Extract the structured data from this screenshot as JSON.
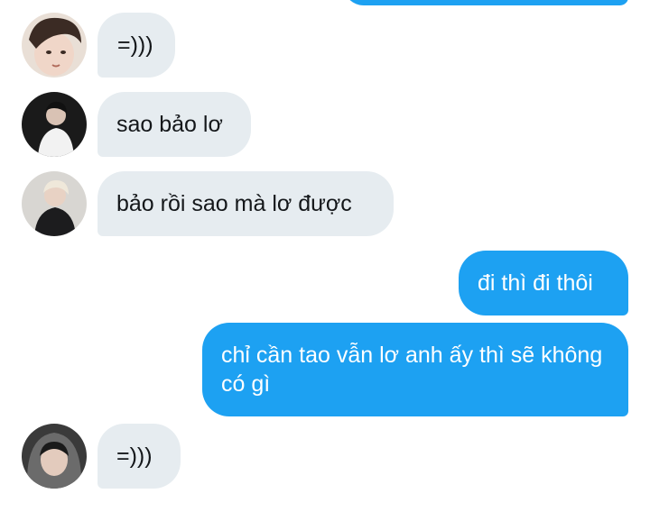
{
  "conversation": {
    "messages": [
      {
        "side": "incoming",
        "avatar": "avatar-1",
        "text": "=)))"
      },
      {
        "side": "incoming",
        "avatar": "avatar-2",
        "text": "sao bảo lơ"
      },
      {
        "side": "incoming",
        "avatar": "avatar-3",
        "text": "bảo rồi sao mà lơ được"
      },
      {
        "side": "outgoing",
        "text": "đi thì đi thôi"
      },
      {
        "side": "outgoing",
        "text": "chỉ cần tao vẫn lơ anh ấy thì sẽ không có gì"
      },
      {
        "side": "incoming",
        "avatar": "avatar-4",
        "text": "=)))"
      }
    ]
  },
  "colors": {
    "incoming_bubble": "#e6ecf0",
    "outgoing_bubble": "#1da1f2",
    "incoming_text": "#14171a",
    "outgoing_text": "#ffffff",
    "background": "#ffffff"
  }
}
